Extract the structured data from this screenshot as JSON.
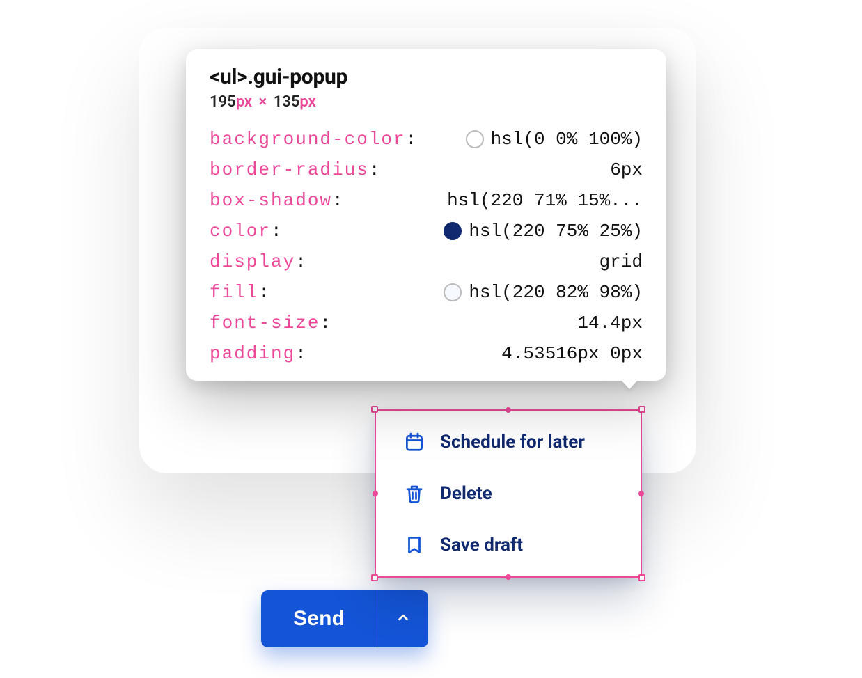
{
  "devtools": {
    "selector_tag": "<ul>",
    "selector_class": ".gui-popup",
    "width_value": "195",
    "width_unit": "px",
    "times_symbol": "×",
    "height_value": "135",
    "height_unit": "px",
    "props": [
      {
        "key": "background-color",
        "value": "hsl(0 0% 100%)",
        "swatch": "white"
      },
      {
        "key": "border-radius",
        "value": "6px"
      },
      {
        "key": "box-shadow",
        "value": "hsl(220 71% 15%..."
      },
      {
        "key": "color",
        "value": "hsl(220 75% 25%)",
        "swatch": "navy"
      },
      {
        "key": "display",
        "value": "grid"
      },
      {
        "key": "fill",
        "value": "hsl(220 82% 98%)",
        "swatch": "pale"
      },
      {
        "key": "font-size",
        "value": "14.4px"
      },
      {
        "key": "padding",
        "value": "4.53516px 0px"
      }
    ]
  },
  "popup": {
    "items": [
      {
        "icon": "calendar-icon",
        "label": "Schedule for later"
      },
      {
        "icon": "trash-icon",
        "label": "Delete"
      },
      {
        "icon": "bookmark-icon",
        "label": "Save draft"
      }
    ]
  },
  "send_button": {
    "label": "Send"
  }
}
